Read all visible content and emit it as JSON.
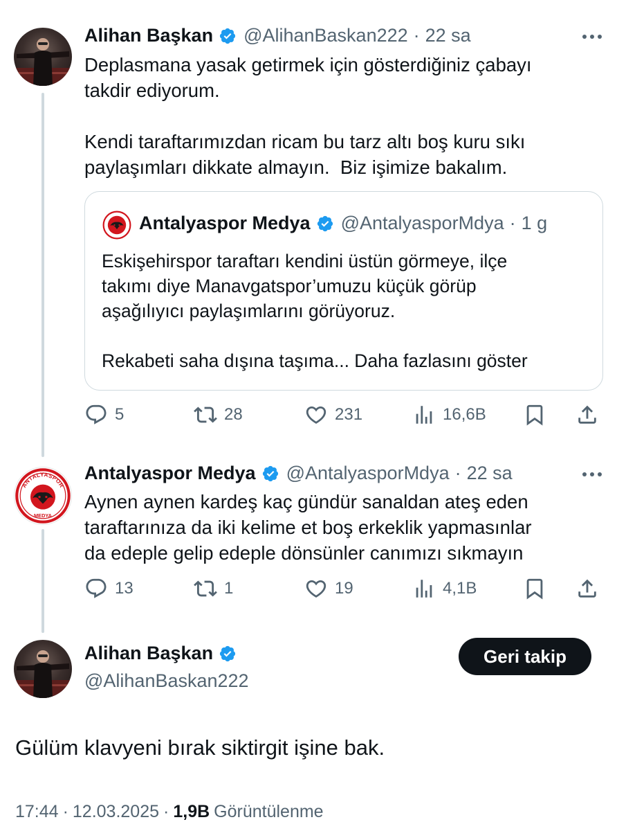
{
  "tweet1": {
    "name": "Alihan Başkan",
    "handle": "@AlihanBaskan222",
    "time": "22 sa",
    "text": "Deplasmana yasak getirmek için gösterdiğiniz çabayı\ntakdir ediyorum.\n\nKendi taraftarımızdan ricam bu tarz altı boş kuru sıkı\npaylaşımları dikkate almayın.  Biz işimize bakalım.",
    "quote": {
      "name": "Antalyaspor Medya",
      "handle": "@AntalyasporMdya",
      "time": "1 g",
      "text": "Eskişehirspor taraftarı kendini üstün görmeye, ilçe\ntakımı diye Manavgatspor’umuzu küçük görüp\naşağılıyıcı paylaşımlarını görüyoruz.\n\nRekabeti saha dışına taşıma... Daha fazlasını göster"
    },
    "stats": {
      "replies": "5",
      "retweets": "28",
      "likes": "231",
      "views": "16,6B"
    }
  },
  "tweet2": {
    "name": "Antalyaspor Medya",
    "handle": "@AntalyasporMdya",
    "time": "22 sa",
    "text": "Aynen aynen kardeş kaç gündür sanaldan ateş eden\ntaraftarınıza da iki kelime et boş erkeklik yapmasınlar\nda edeple gelip edeple dönsünler canımızı sıkmayın",
    "stats": {
      "replies": "13",
      "retweets": "1",
      "likes": "19",
      "views": "4,1B"
    }
  },
  "main": {
    "name": "Alihan Başkan",
    "handle": "@AlihanBaskan222",
    "follow_label": "Geri takip",
    "text": "Gülüm klavyeni bırak siktirgit işine bak.",
    "time": "17:44",
    "date": "12.03.2025",
    "views_count": "1,9B",
    "views_label": "Görüntülenme"
  },
  "logo": {
    "top_text": "ANTALYASPOR",
    "bottom_text": "MEDYA"
  },
  "colors": {
    "verified": "#1d9bf0",
    "text": "#0f1419",
    "secondary": "#536471",
    "border": "#cfd9de",
    "logo_red": "#d2161e"
  },
  "icons": [
    "verified-badge-icon",
    "more-icon",
    "reply-icon",
    "retweet-icon",
    "like-icon",
    "views-icon",
    "bookmark-icon",
    "share-icon"
  ]
}
